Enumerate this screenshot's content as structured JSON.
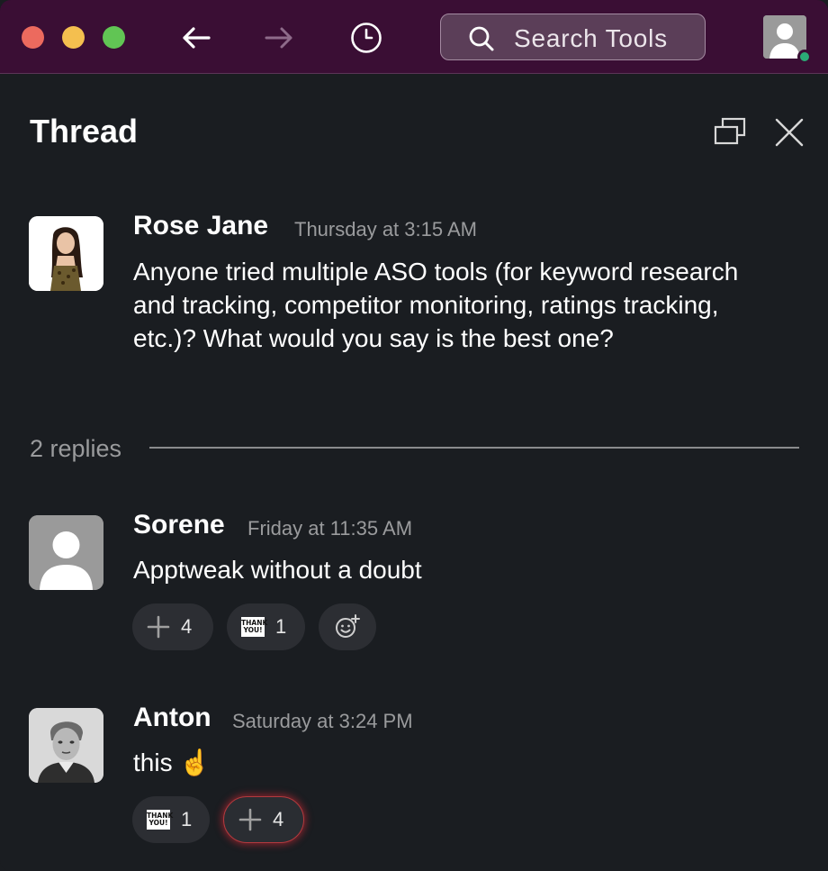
{
  "titlebar": {
    "search_placeholder": "Search Tools"
  },
  "thread": {
    "title": "Thread"
  },
  "parent_message": {
    "author": "Rose Jane",
    "timestamp": "Thursday at 3:15 AM",
    "text": "Anyone tried multiple ASO tools (for keyword research and tracking, competitor monitoring, ratings tracking, etc.)? What would you say is the best one?"
  },
  "replies": {
    "label": "2 replies",
    "items": [
      {
        "author": "Sorene",
        "timestamp": "Friday at 11:35 AM",
        "text": "Apptweak without a doubt",
        "reactions": [
          {
            "icon": "plus-icon",
            "count": "4"
          },
          {
            "icon": "thank-you-icon",
            "label": "THANK YOU!",
            "count": "1"
          },
          {
            "icon": "add-reaction-icon"
          }
        ]
      },
      {
        "author": "Anton",
        "timestamp": "Saturday at 3:24 PM",
        "text": "this ☝️",
        "reactions": [
          {
            "icon": "thank-you-icon",
            "label": "THANK YOU!",
            "count": "1"
          },
          {
            "icon": "plus-icon",
            "count": "4",
            "highlighted": true
          }
        ]
      }
    ]
  },
  "colors": {
    "titlebar_bg": "#3a0e34",
    "panel_bg": "#1a1d21",
    "reaction_bg": "#2c2e33",
    "highlight_glow": "#d62834",
    "presence": "#2bac76"
  }
}
